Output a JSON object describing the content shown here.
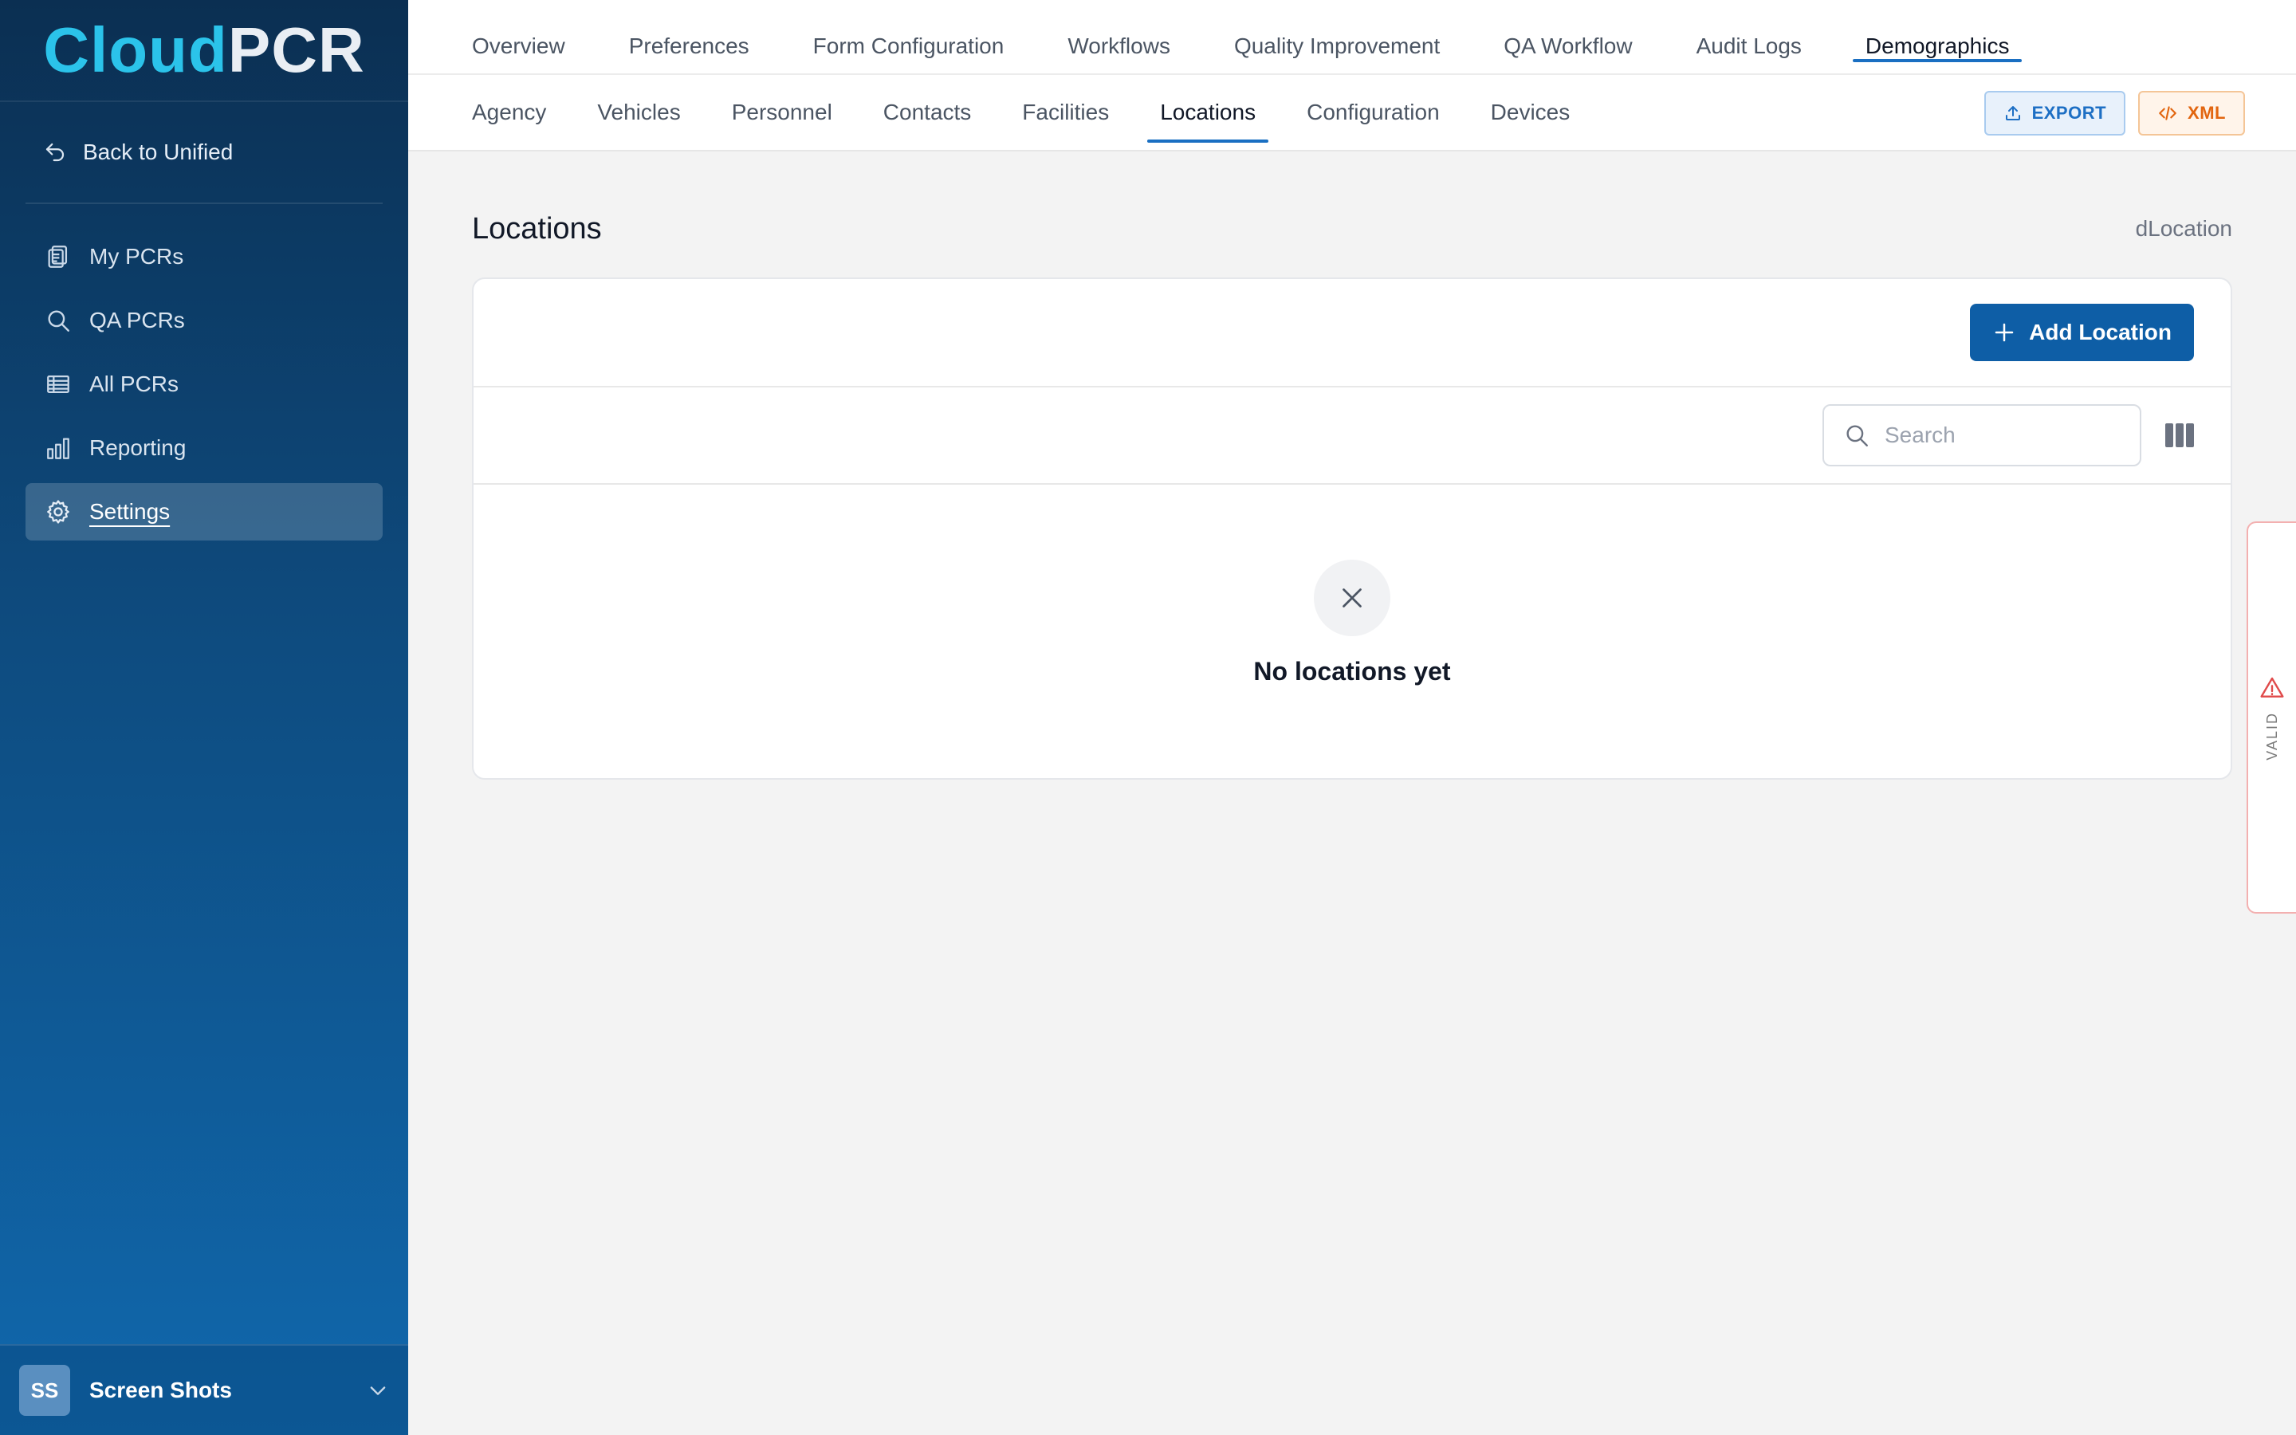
{
  "brand": {
    "part1": "Cloud",
    "part2": "PCR"
  },
  "sidebar": {
    "back_label": "Back to Unified",
    "items": [
      {
        "label": "My PCRs",
        "icon": "clipboard-icon"
      },
      {
        "label": "QA PCRs",
        "icon": "search-icon"
      },
      {
        "label": "All PCRs",
        "icon": "table-icon"
      },
      {
        "label": "Reporting",
        "icon": "bar-chart-icon"
      },
      {
        "label": "Settings",
        "icon": "gear-icon",
        "active": true
      }
    ],
    "user": {
      "initials": "SS",
      "name": "Screen Shots"
    }
  },
  "topnav": {
    "tabs": [
      "Overview",
      "Preferences",
      "Form Configuration",
      "Workflows",
      "Quality Improvement",
      "QA Workflow",
      "Audit Logs",
      "Demographics"
    ],
    "active": "Demographics"
  },
  "subnav": {
    "tabs": [
      "Agency",
      "Vehicles",
      "Personnel",
      "Contacts",
      "Facilities",
      "Locations",
      "Configuration",
      "Devices"
    ],
    "active": "Locations",
    "export_label": "EXPORT",
    "xml_label": "XML"
  },
  "page": {
    "title": "Locations",
    "code": "dLocation",
    "add_button": "Add Location",
    "search_placeholder": "Search",
    "empty_message": "No locations yet"
  },
  "validation": {
    "label": "VALID"
  },
  "colors": {
    "accent": "#1a6fc2",
    "primary_button": "#0e5ea6",
    "brand_cyan": "#2bc3ea",
    "xml_orange": "#e2650f",
    "warning_red": "#e04b4b"
  }
}
